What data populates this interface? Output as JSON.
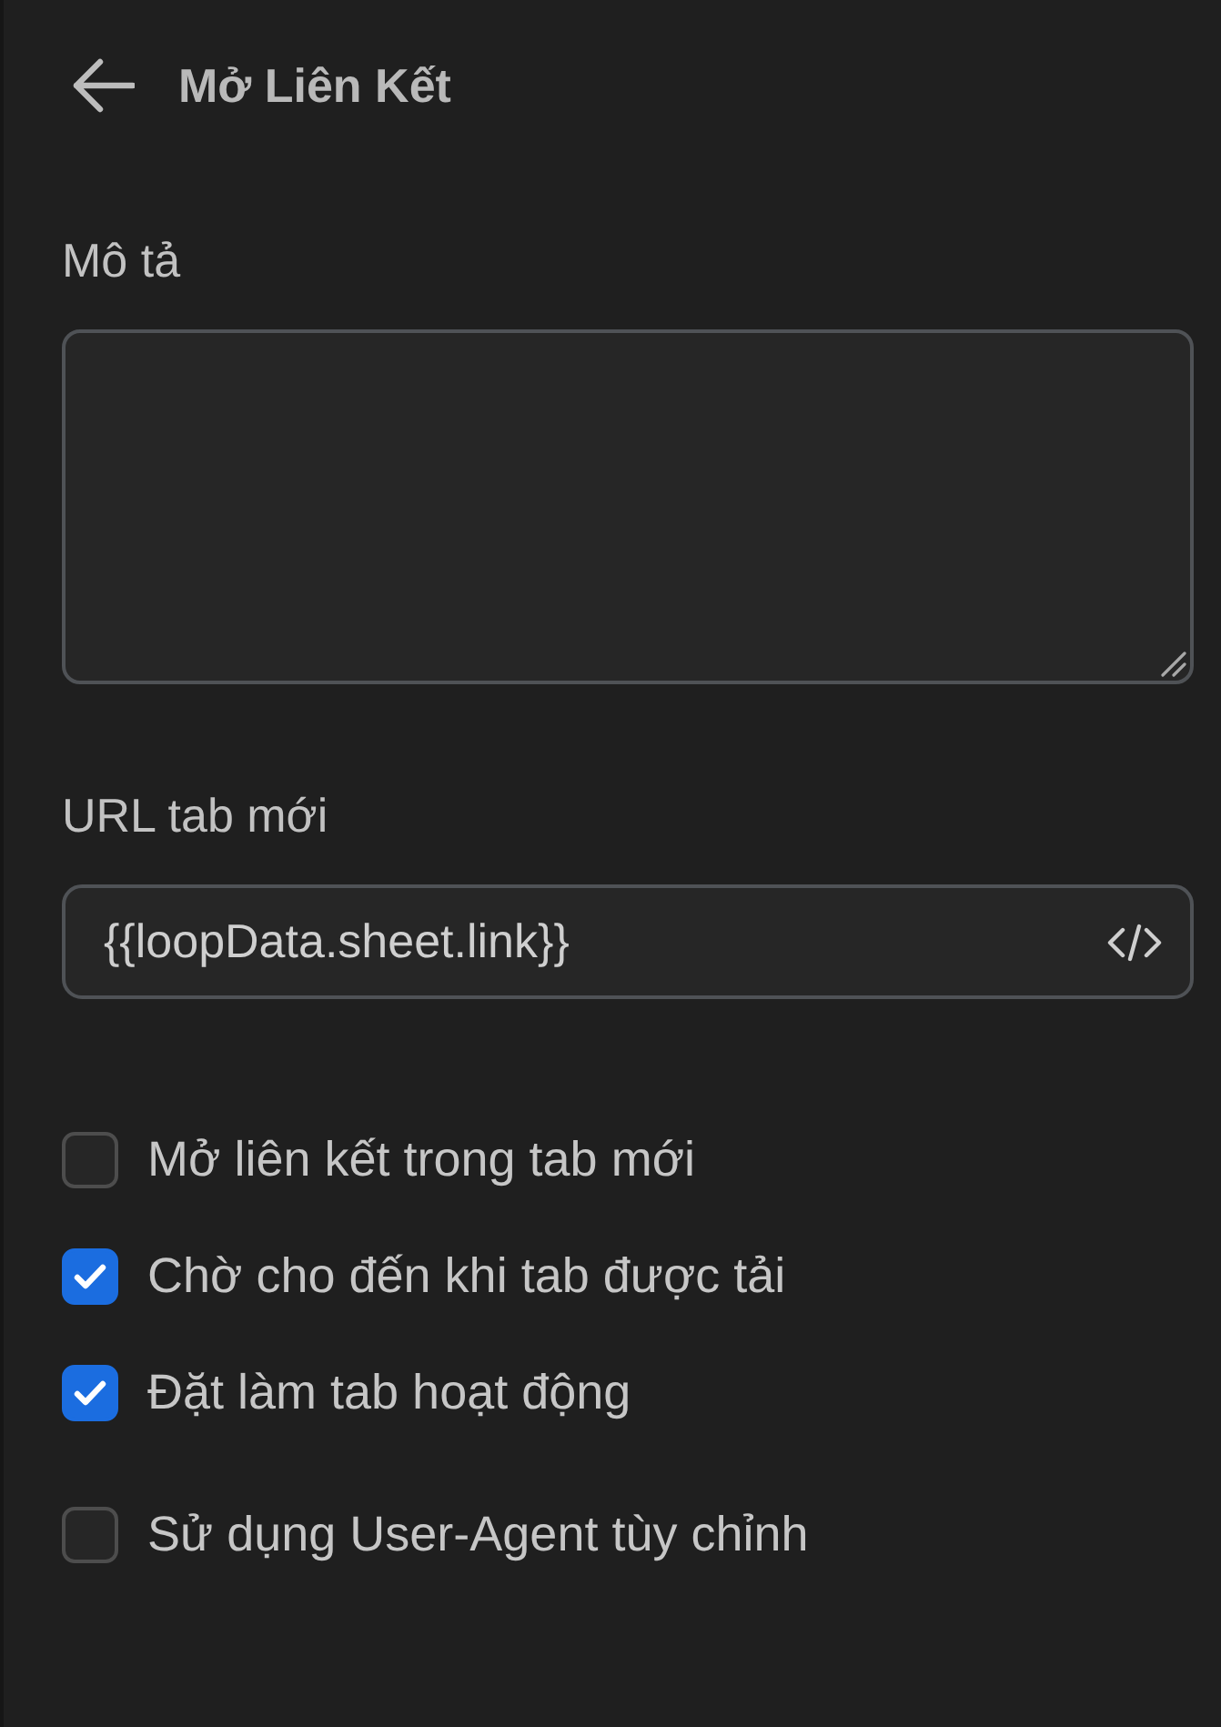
{
  "header": {
    "title": "Mở Liên Kết"
  },
  "fields": [
    {
      "kind": "textarea",
      "label": "Mô tả"
    },
    {
      "kind": "expression",
      "label": "URL tab mới",
      "value": "{{loopData.sheet.link}}"
    }
  ],
  "option_groups": [
    {
      "options": [
        {
          "label": "Mở liên kết trong tab mới",
          "checked": false
        },
        {
          "label": "Chờ cho đến khi tab được tải",
          "checked": true
        },
        {
          "label": "Đặt làm tab hoạt động",
          "checked": true
        }
      ]
    },
    {
      "options": [
        {
          "label": "Sử dụng User-Agent tùy chỉnh",
          "checked": false
        }
      ]
    }
  ]
}
